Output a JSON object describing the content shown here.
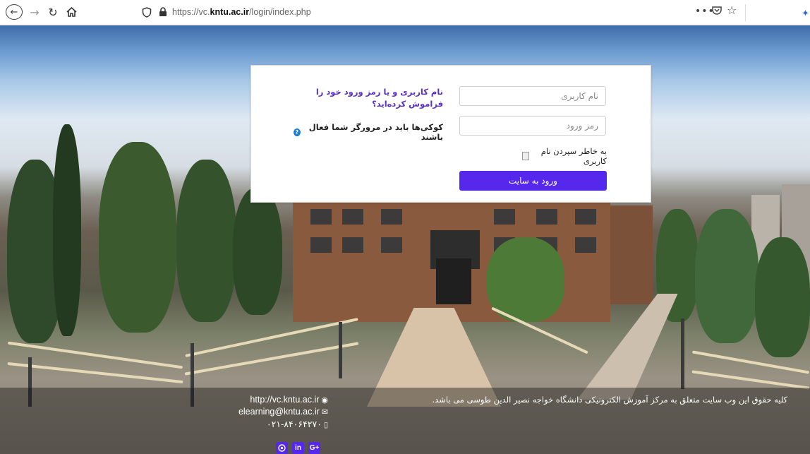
{
  "browser": {
    "url_host": "https://vc.",
    "url_bold": "kntu.ac.ir",
    "url_path": "/login/index.php",
    "more_label": "•••"
  },
  "login": {
    "username_placeholder": "نام کاربری",
    "password_placeholder": "رمز ورود",
    "remember_label": "به خاطر سپردن نام کاربری",
    "login_button": "ورود به سایت",
    "forgot_text": "نام کاربری و یا رمز ورود خود را فراموش کرده‌اید؟",
    "cookies_text": "کوکی‌ها باید در مرورگر شما فعال باشند",
    "accent_color": "#5628ee"
  },
  "footer": {
    "website": "http://vc.kntu.ac.ir",
    "email": "elearning@kntu.ac.ir",
    "phone": "۰۲۱-۸۴۰۶۴۲۷۰",
    "copyright": "کلیه حقوق این وب سایت متعلق به مرکز آموزش الکترونیکی دانشگاه خواجه نصیر الدین طوسی می باشد.",
    "social": [
      "globe-icon",
      "linkedin-icon",
      "google-plus-icon"
    ],
    "social_labels": [
      "",
      "in",
      "G+"
    ]
  }
}
